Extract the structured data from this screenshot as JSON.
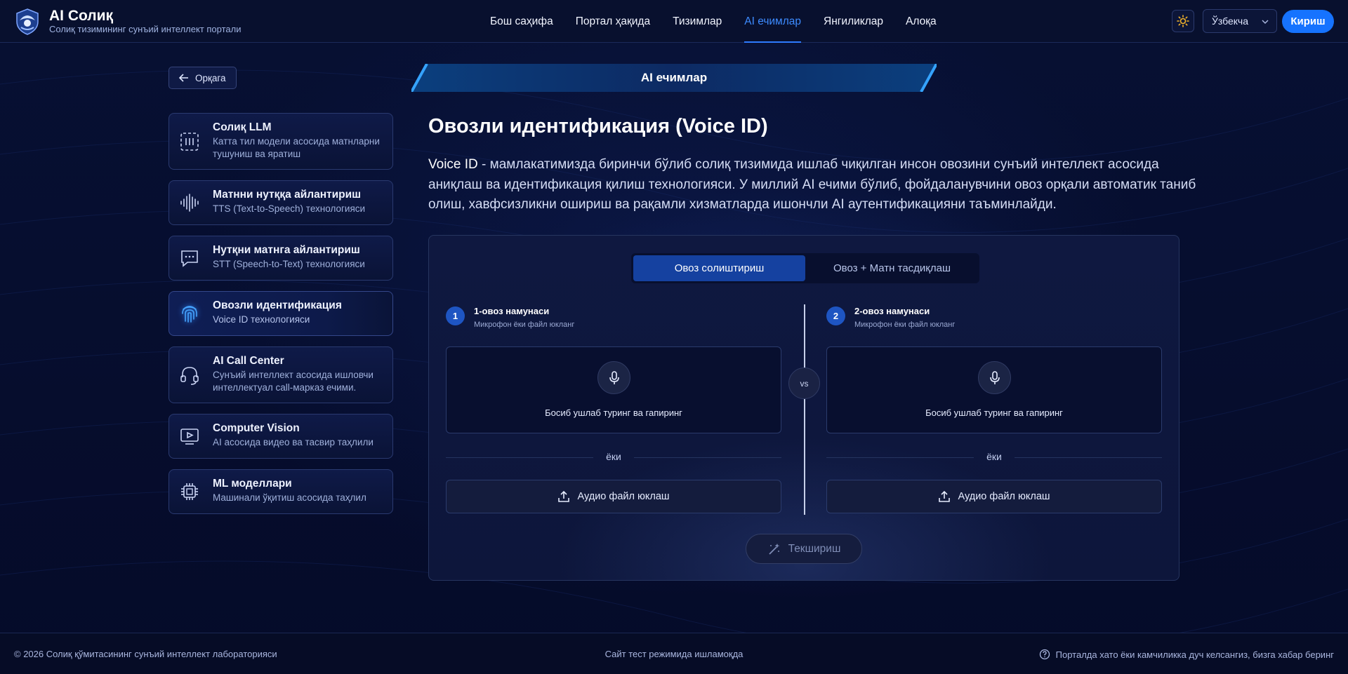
{
  "header": {
    "brand_title": "AI Солиқ",
    "brand_subtitle": "Солиқ тизимининг сунъий интеллект портали",
    "nav": [
      {
        "label": "Бош саҳифа",
        "active": false
      },
      {
        "label": "Портал ҳақида",
        "active": false
      },
      {
        "label": "Тизимлар",
        "active": false
      },
      {
        "label": "AI ечимлар",
        "active": true
      },
      {
        "label": "Янгиликлар",
        "active": false
      },
      {
        "label": "Алоқа",
        "active": false
      }
    ],
    "language": "Ўзбекча",
    "login_label": "Кириш",
    "accent_color": "#1673ff"
  },
  "back_label": "Орқага",
  "sidebar": {
    "items": [
      {
        "title": "Солиқ LLM",
        "desc": "Катта тил модели асосида матнларни тушуниш ва яратиш",
        "icon": "llm-icon"
      },
      {
        "title": "Матнни нутққа айлантириш",
        "desc": "TTS (Text-to-Speech) технологияси",
        "icon": "waveform-icon"
      },
      {
        "title": "Нутқни матнга айлантириш",
        "desc": "STT (Speech-to-Text) технологияси",
        "icon": "chat-icon"
      },
      {
        "title": "Овозли идентификация",
        "desc": "Voice ID технологияси",
        "icon": "fingerprint-icon",
        "active": true
      },
      {
        "title": "AI Call Center",
        "desc": "Сунъий интеллект асосида ишловчи интеллектуал call-марказ ечими.",
        "icon": "headset-icon"
      },
      {
        "title": "Computer Vision",
        "desc": "AI асосида видео ва тасвир таҳлили",
        "icon": "video-icon"
      },
      {
        "title": "ML моделлари",
        "desc": "Машинали ўқитиш асосида таҳлил",
        "icon": "chip-icon"
      }
    ]
  },
  "main": {
    "banner": "AI ечимлар",
    "title": "Овозли идентификация (Voice ID)",
    "desc_strong": "Voice ID",
    "desc_rest": " - мамлакатимизда биринчи бўлиб солиқ тизимида ишлаб чиқилган инсон овозини сунъий интеллект асосида аниқлаш ва идентификация қилиш технологияси. У миллий AI ечими бўлиб, фойдаланувчини овоз орқали автоматик таниб олиш, хавфсизликни ошириш ва рақамли хизматларда ишончли AI аутентификацияни таъминлайди.",
    "tabs": [
      {
        "label": "Овоз солиштириш",
        "active": true
      },
      {
        "label": "Овоз + Матн тасдиқлаш",
        "active": false
      }
    ],
    "samples": [
      {
        "num": "1",
        "title": "1-овоз намунаси",
        "subtitle": "Микрофон ёки файл юкланг",
        "record_label": "Босиб ушлаб туринг ва гапиринг",
        "or": "ёки",
        "upload_label": "Аудио файл юклаш"
      },
      {
        "num": "2",
        "title": "2-овоз намунаси",
        "subtitle": "Микрофон ёки файл юкланг",
        "record_label": "Босиб ушлаб туринг ва гапиринг",
        "or": "ёки",
        "upload_label": "Аудио файл юклаш"
      }
    ],
    "vs": "vs",
    "check_label": "Текшириш"
  },
  "footer": {
    "copyright": "© 2026 Солиқ қўмитасининг сунъий интеллект лабораторияси",
    "test_mode": "Сайт тест режимида ишламоқда",
    "report": "Порталда хато ёки камчиликка дуч келсангиз, бизга хабар беринг"
  }
}
